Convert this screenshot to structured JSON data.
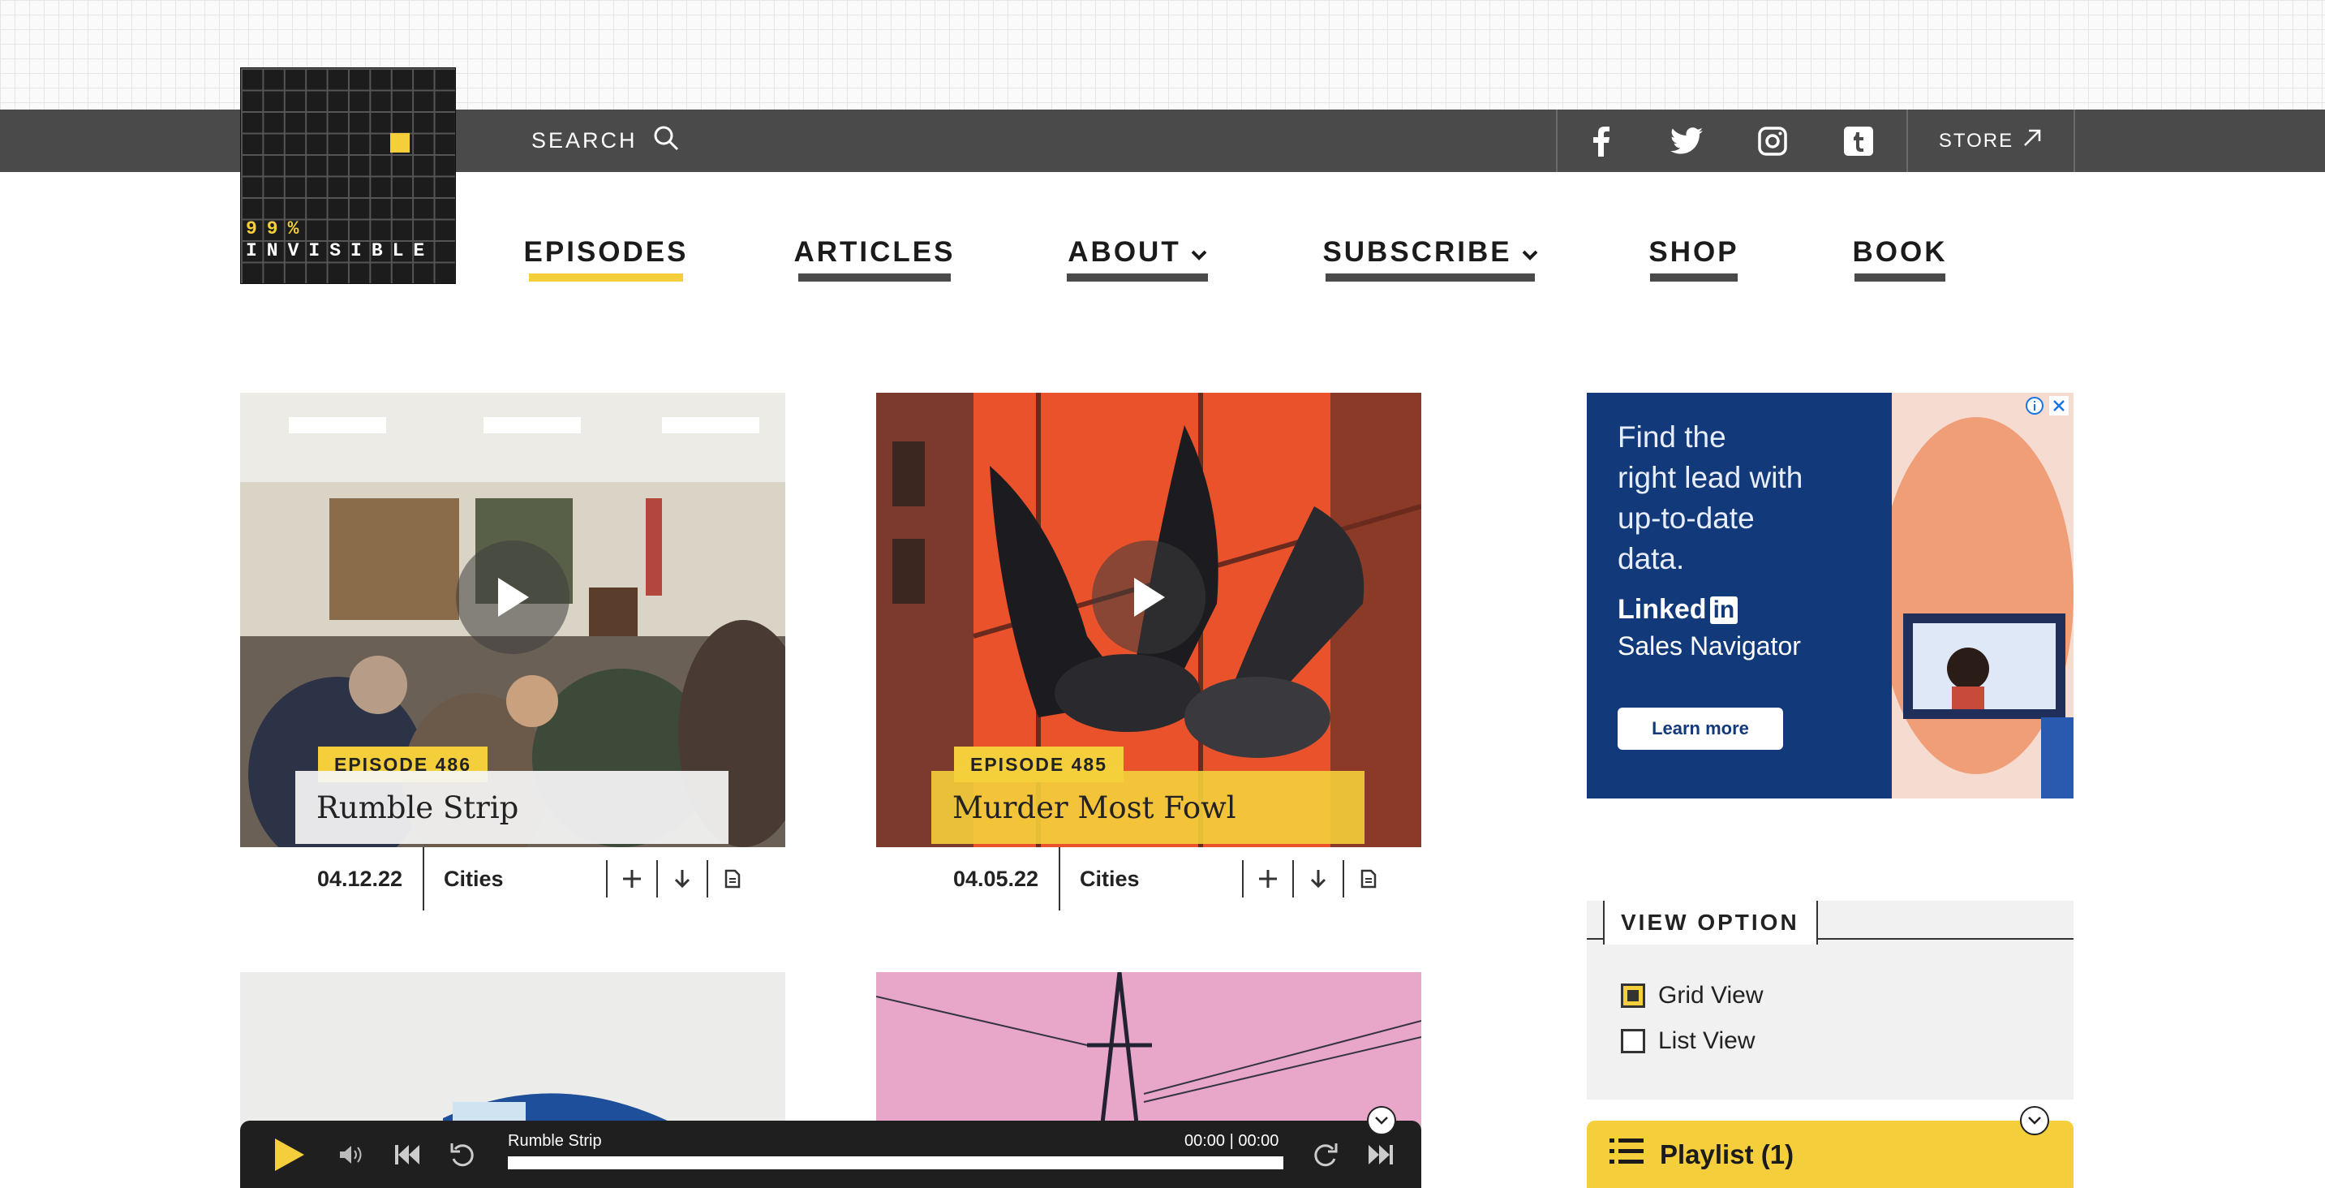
{
  "header": {
    "logo_percent": "99%",
    "logo_name": "INVISIBLE",
    "search_label": "SEARCH",
    "store_label": "STORE"
  },
  "nav": [
    {
      "label": "EPISODES",
      "active": true
    },
    {
      "label": "ARTICLES",
      "active": false
    },
    {
      "label": "ABOUT",
      "dropdown": true
    },
    {
      "label": "SUBSCRIBE",
      "dropdown": true
    },
    {
      "label": "SHOP"
    },
    {
      "label": "BOOK"
    }
  ],
  "episodes": [
    {
      "badge": "EPISODE 486",
      "title": "Rumble Strip",
      "date": "04.12.22",
      "category": "Cities"
    },
    {
      "badge": "EPISODE 485",
      "title": "Murder Most Fowl",
      "date": "04.05.22",
      "category": "Cities"
    }
  ],
  "ad": {
    "headline_1": "Find the",
    "headline_2": "right lead with",
    "headline_3": "up-to-date",
    "headline_4": "data.",
    "brand": "Linked",
    "brand_in": "in",
    "product": "Sales Navigator",
    "cta": "Learn more"
  },
  "view_option": {
    "title": "VIEW OPTION",
    "grid_label": "Grid View",
    "list_label": "List View",
    "selected": "Grid View"
  },
  "playlist": {
    "label": "Playlist (1)"
  },
  "player": {
    "track": "Rumble Strip",
    "time": "00:00 | 00:00"
  },
  "colors": {
    "accent": "#f4cf3b",
    "topbar": "#4a4a4a",
    "player": "#1f1f1f",
    "ad_bg": "#123a7a"
  }
}
